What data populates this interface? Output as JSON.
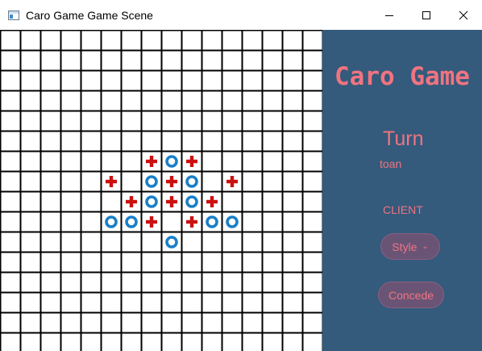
{
  "window": {
    "title": "Caro Game Game Scene"
  },
  "board": {
    "cols": 16,
    "rows": 16,
    "pieces": [
      {
        "col": 7,
        "row": 6,
        "mark": "X"
      },
      {
        "col": 8,
        "row": 6,
        "mark": "O"
      },
      {
        "col": 9,
        "row": 6,
        "mark": "X"
      },
      {
        "col": 5,
        "row": 7,
        "mark": "X"
      },
      {
        "col": 7,
        "row": 7,
        "mark": "O"
      },
      {
        "col": 8,
        "row": 7,
        "mark": "X"
      },
      {
        "col": 9,
        "row": 7,
        "mark": "O"
      },
      {
        "col": 11,
        "row": 7,
        "mark": "X"
      },
      {
        "col": 6,
        "row": 8,
        "mark": "X"
      },
      {
        "col": 7,
        "row": 8,
        "mark": "O"
      },
      {
        "col": 8,
        "row": 8,
        "mark": "X"
      },
      {
        "col": 9,
        "row": 8,
        "mark": "O"
      },
      {
        "col": 10,
        "row": 8,
        "mark": "X"
      },
      {
        "col": 5,
        "row": 9,
        "mark": "O"
      },
      {
        "col": 6,
        "row": 9,
        "mark": "O"
      },
      {
        "col": 7,
        "row": 9,
        "mark": "X"
      },
      {
        "col": 9,
        "row": 9,
        "mark": "X"
      },
      {
        "col": 10,
        "row": 9,
        "mark": "O"
      },
      {
        "col": 11,
        "row": 9,
        "mark": "O"
      },
      {
        "col": 8,
        "row": 10,
        "mark": "O"
      }
    ]
  },
  "panel": {
    "title": "Caro Game",
    "turn_label": "Turn",
    "turn_player": "toan",
    "role": "CLIENT",
    "style_button": "Style",
    "concede_button": "Concede"
  },
  "colors": {
    "panel_bg": "#345a7c",
    "accent": "#f07480",
    "x_mark": "#cc1010",
    "o_mark": "#1a7fc8",
    "grid": "#000000"
  },
  "icons": {
    "x_mark": "red-plus-icon",
    "o_mark": "blue-ring-icon",
    "style_chevron": "chevron-down-icon"
  }
}
